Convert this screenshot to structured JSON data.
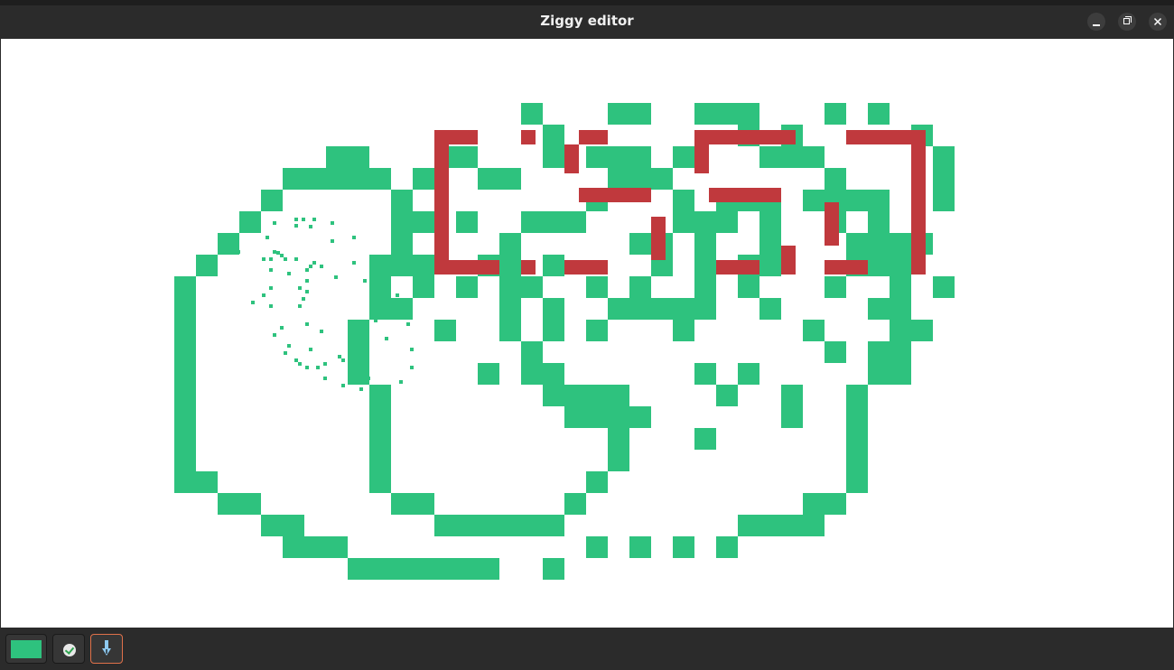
{
  "window": {
    "title": "Ziggy editor"
  },
  "controls": {
    "minimize_icon": "minimize-icon",
    "maximize_icon": "restore-icon",
    "close_icon": "close-icon"
  },
  "colors": {
    "green": "#2ec27e",
    "red": "#c0393d",
    "swatch": "#2ec27e"
  },
  "toolbar": {
    "color_swatch": "#2ec27e",
    "check_icon": "check-circle-icon",
    "picker_icon": "pen-nib-icon"
  }
}
